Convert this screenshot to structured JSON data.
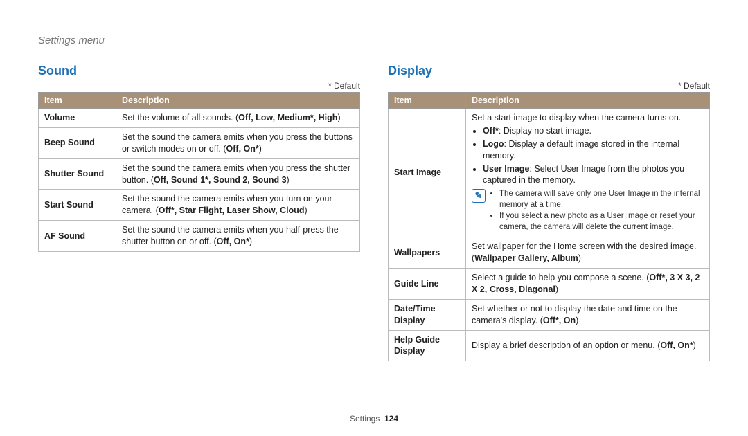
{
  "breadcrumb": "Settings menu",
  "default_note": "* Default",
  "headers": {
    "item": "Item",
    "desc": "Description"
  },
  "sound": {
    "title": "Sound",
    "rows": [
      {
        "item": "Volume",
        "desc_pre": "Set the volume of all sounds. (",
        "opts": "Off, Low, Medium*, High",
        "desc_post": ")"
      },
      {
        "item": "Beep Sound",
        "desc_pre": "Set the sound the camera emits when you press the buttons or switch modes on or off. (",
        "opts": "Off, On*",
        "desc_post": ")"
      },
      {
        "item": "Shutter Sound",
        "desc_pre": "Set the sound the camera emits when you press the shutter button. (",
        "opts": "Off, Sound 1*, Sound 2, Sound 3",
        "desc_post": ")"
      },
      {
        "item": "Start Sound",
        "desc_pre": "Set the sound the camera emits when you turn on your camera. (",
        "opts": "Off*, Star Flight, Laser Show, Cloud",
        "desc_post": ")"
      },
      {
        "item": "AF Sound",
        "desc_pre": "Set the sound the camera emits when you half-press the shutter button on or off. (",
        "opts": "Off, On*",
        "desc_post": ")"
      }
    ]
  },
  "display": {
    "title": "Display",
    "start_image": {
      "item": "Start Image",
      "lead": "Set a start image to display when the camera turns on.",
      "b1_label": "Off*",
      "b1_text": ": Display no start image.",
      "b2_label": "Logo",
      "b2_text": ": Display a default image stored in the internal memory.",
      "b3_label": "User Image",
      "b3_text": ": Select User Image from the photos you captured in the memory.",
      "note1": "The camera will save only one User Image in the internal memory at a time.",
      "note2": "If you select a new photo as a User Image or reset your camera, the camera will delete the current image."
    },
    "wallpapers": {
      "item": "Wallpapers",
      "pre": "Set wallpaper for the Home screen with the desired image. (",
      "opts": "Wallpaper Gallery, Album",
      "post": ")"
    },
    "guide": {
      "item": "Guide Line",
      "pre": "Select a guide to help you compose a scene. (",
      "opts": "Off*, 3 X 3, 2 X 2, Cross, Diagonal",
      "post": ")"
    },
    "datetime": {
      "item": "Date/Time Display",
      "pre": "Set whether or not to display the date and time on the camera's display. (",
      "opts": "Off*, On",
      "post": ")"
    },
    "help": {
      "item": "Help Guide Display",
      "pre": "Display a brief description of an option or menu. (",
      "opts": "Off, On*",
      "post": ")"
    }
  },
  "footer": {
    "section": "Settings",
    "page": "124"
  },
  "note_glyph": "✎"
}
